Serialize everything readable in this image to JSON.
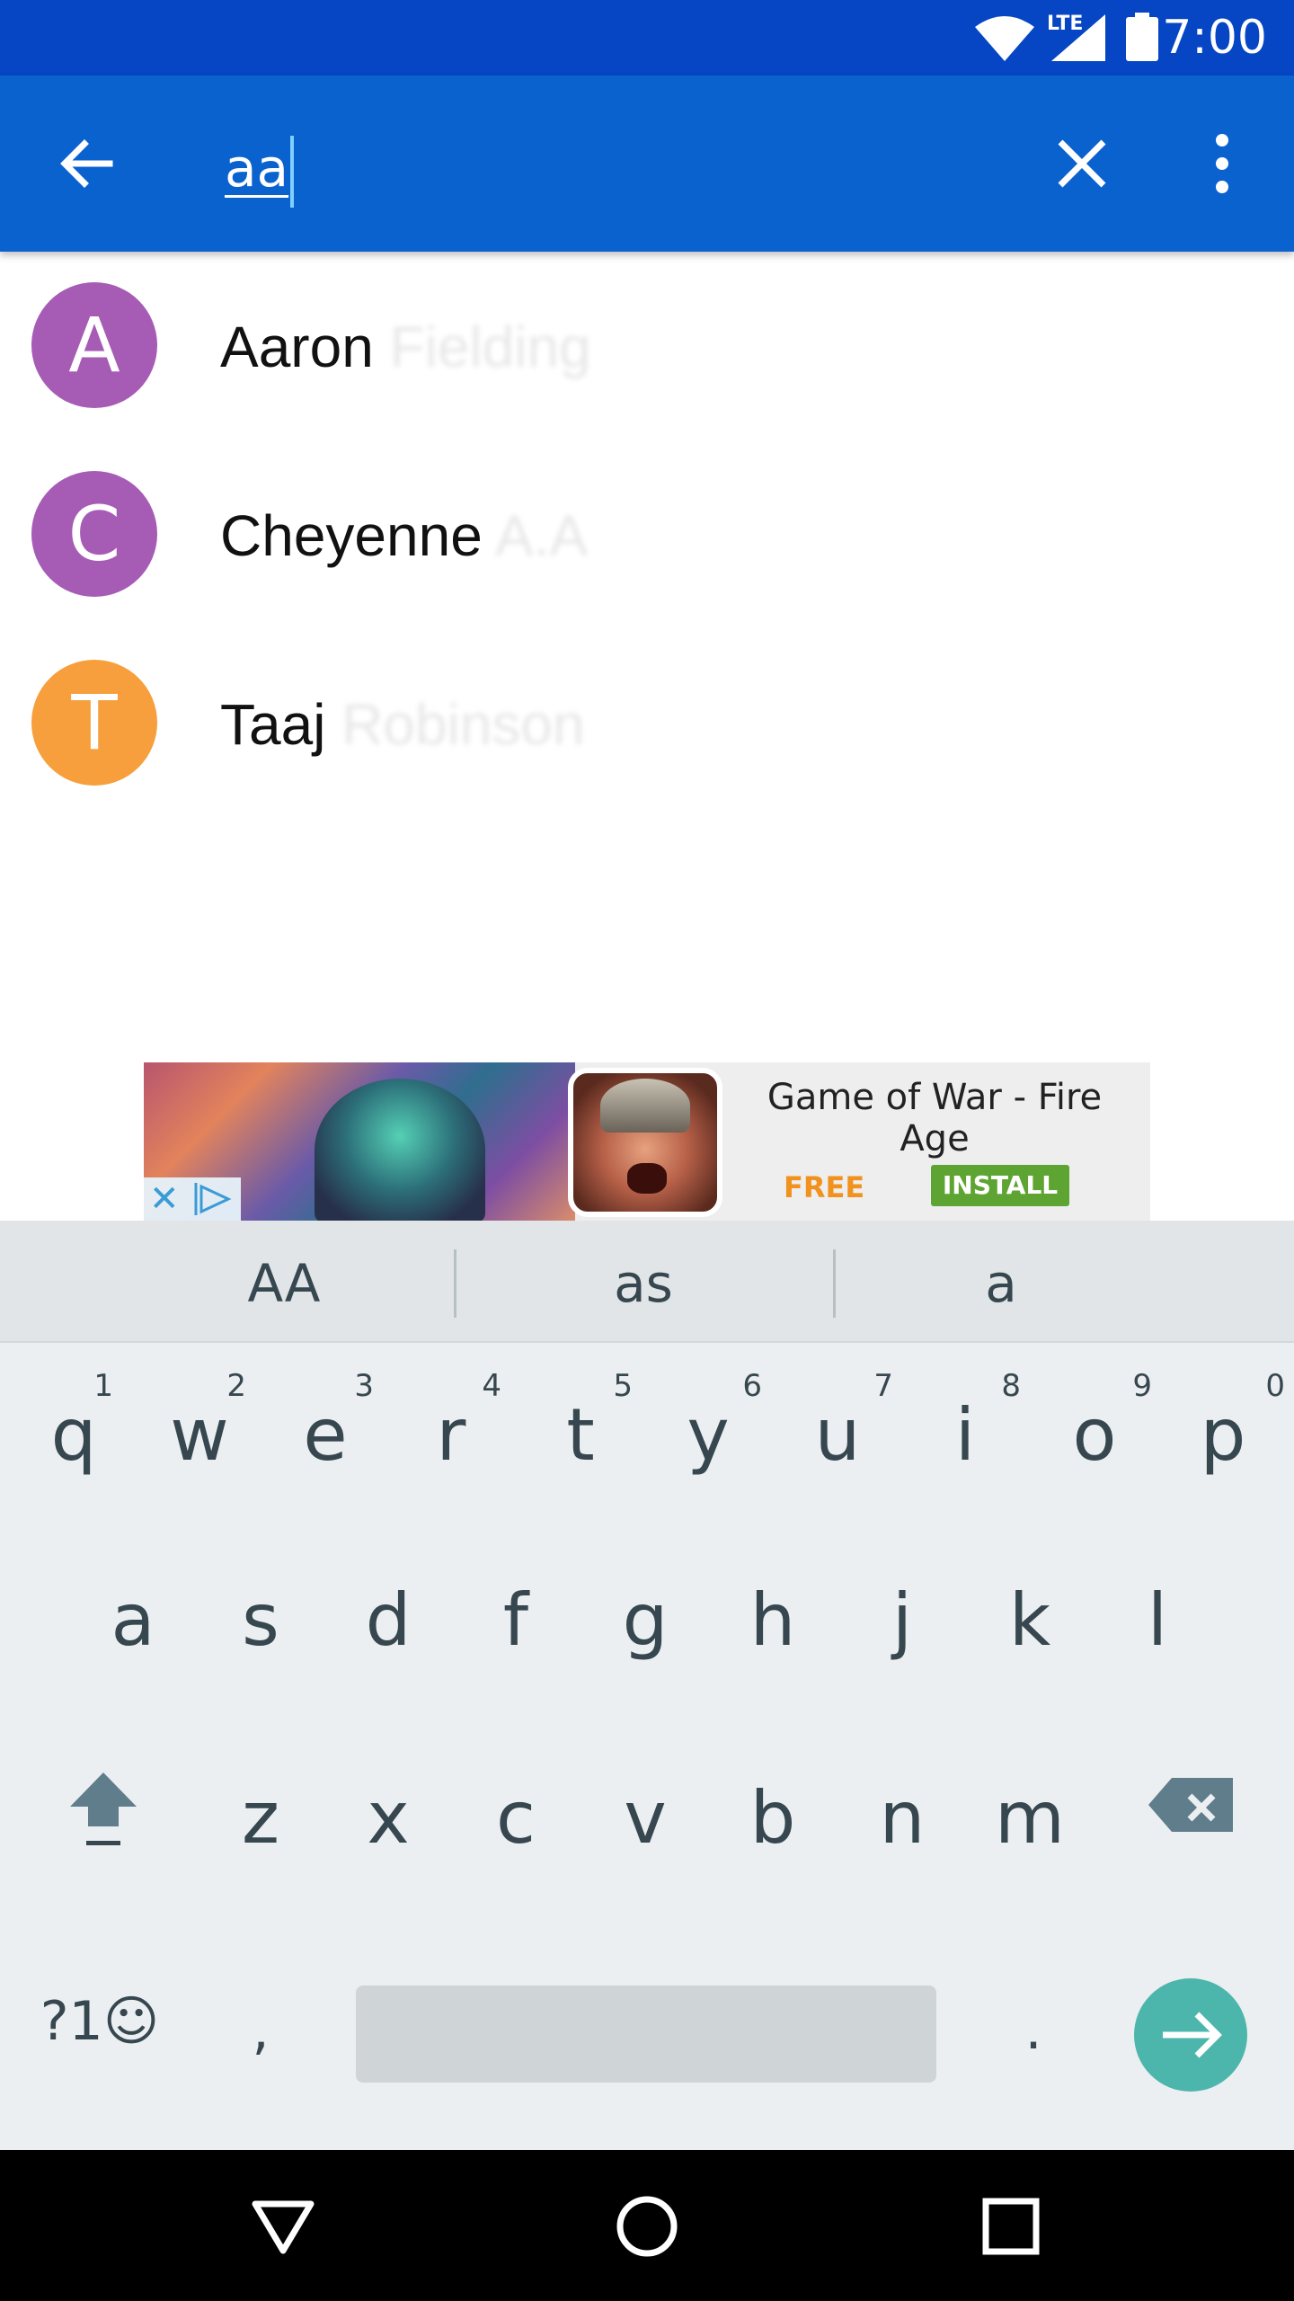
{
  "status_bar": {
    "time": "7:00",
    "network": "LTE",
    "icons": [
      "wifi-icon",
      "lte-signal-icon",
      "battery-icon"
    ]
  },
  "toolbar": {
    "back_icon": "arrow-back-icon",
    "query": "aa",
    "clear_icon": "close-icon",
    "more_icon": "more-vert-icon",
    "color": "#0a62cf"
  },
  "contacts": [
    {
      "initial": "A",
      "first": "Aaron",
      "rest": "Fielding",
      "color": "#a65cb5"
    },
    {
      "initial": "C",
      "first": "Cheyenne",
      "rest": "A.A",
      "color": "#a65cb5"
    },
    {
      "initial": "T",
      "first": "Taaj",
      "rest": "Robinson",
      "color": "#f79f3d"
    }
  ],
  "ad": {
    "title": "Game of War - Fire Age",
    "price": "FREE",
    "install": "INSTALL"
  },
  "keyboard": {
    "suggestions": [
      "AA",
      "as",
      "a"
    ],
    "row1": [
      {
        "ch": "q",
        "num": "1"
      },
      {
        "ch": "w",
        "num": "2"
      },
      {
        "ch": "e",
        "num": "3"
      },
      {
        "ch": "r",
        "num": "4"
      },
      {
        "ch": "t",
        "num": "5"
      },
      {
        "ch": "y",
        "num": "6"
      },
      {
        "ch": "u",
        "num": "7"
      },
      {
        "ch": "i",
        "num": "8"
      },
      {
        "ch": "o",
        "num": "9"
      },
      {
        "ch": "p",
        "num": "0"
      }
    ],
    "row2": [
      "a",
      "s",
      "d",
      "f",
      "g",
      "h",
      "j",
      "k",
      "l"
    ],
    "row3": [
      "z",
      "x",
      "c",
      "v",
      "b",
      "n",
      "m"
    ],
    "symbols": "?1☺",
    "comma": ",",
    "period": "."
  },
  "navbar": {
    "icons": [
      "back-triangle-icon",
      "home-circle-icon",
      "recents-square-icon"
    ]
  }
}
